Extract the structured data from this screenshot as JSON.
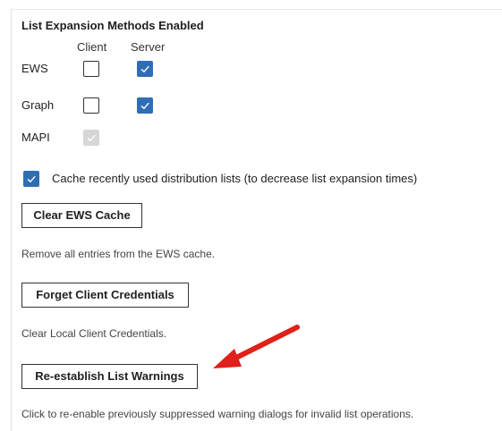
{
  "section": {
    "title": "List Expansion Methods Enabled",
    "columns": {
      "client": "Client",
      "server": "Server"
    },
    "rows": [
      {
        "label": "EWS",
        "client_checked": false,
        "server_checked": true
      },
      {
        "label": "Graph",
        "client_checked": false,
        "server_checked": true
      },
      {
        "label": "MAPI",
        "client_checked": true,
        "client_disabled": true
      }
    ]
  },
  "cache": {
    "checked": true,
    "label": "Cache recently used distribution lists (to decrease list expansion times)"
  },
  "clear_ews": {
    "button_label": "Clear EWS Cache",
    "description": "Remove all entries from the EWS cache."
  },
  "forget_credentials": {
    "button_label": "Forget Client Credentials",
    "description": "Clear Local Client Credentials."
  },
  "reestablish_warnings": {
    "button_label": "Re-establish List Warnings",
    "description": "Click to re-enable previously suppressed warning dialogs for invalid list operations."
  },
  "colors": {
    "checkbox_checked": "#2f6db5",
    "checkbox_disabled": "#d6d6d6",
    "annotation_arrow": "#e0201b"
  }
}
